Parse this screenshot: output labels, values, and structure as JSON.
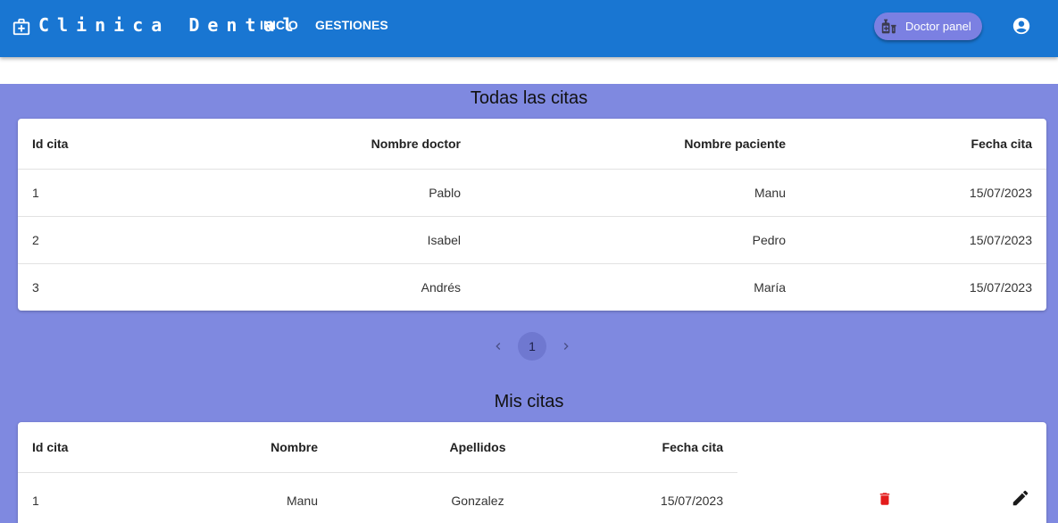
{
  "appbar": {
    "brand": "Clinica Dental",
    "brand_icon": "medical-briefcase-icon",
    "nav": [
      "INICIO",
      "GESTIONES"
    ],
    "doctor_panel_label": "Doctor panel",
    "doctor_panel_icon": "medical-icon",
    "account_icon": "account-circle-icon"
  },
  "all_appointments": {
    "title": "Todas las citas",
    "headers": [
      "Id cita",
      "Nombre doctor",
      "Nombre paciente",
      "Fecha cita"
    ],
    "rows": [
      [
        "1",
        "Pablo",
        "Manu",
        "15/07/2023"
      ],
      [
        "2",
        "Isabel",
        "Pedro",
        "15/07/2023"
      ],
      [
        "3",
        "Andrés",
        "María",
        "15/07/2023"
      ]
    ]
  },
  "pagination": {
    "current_page": "1",
    "prev_icon": "chevron-left-icon",
    "next_icon": "chevron-right-icon"
  },
  "my_appointments": {
    "title": "Mis citas",
    "headers": [
      "Id cita",
      "Nombre",
      "Apellidos",
      "Fecha cita"
    ],
    "rows": [
      [
        "1",
        "Manu",
        "Gonzalez",
        "15/07/2023"
      ]
    ],
    "delete_icon": "trash-icon",
    "edit_icon": "pencil-icon"
  },
  "colors": {
    "appbar": "#1976d2",
    "background": "#7f89e0",
    "chip": "#7b80e2",
    "delete": "#e31b1b"
  }
}
